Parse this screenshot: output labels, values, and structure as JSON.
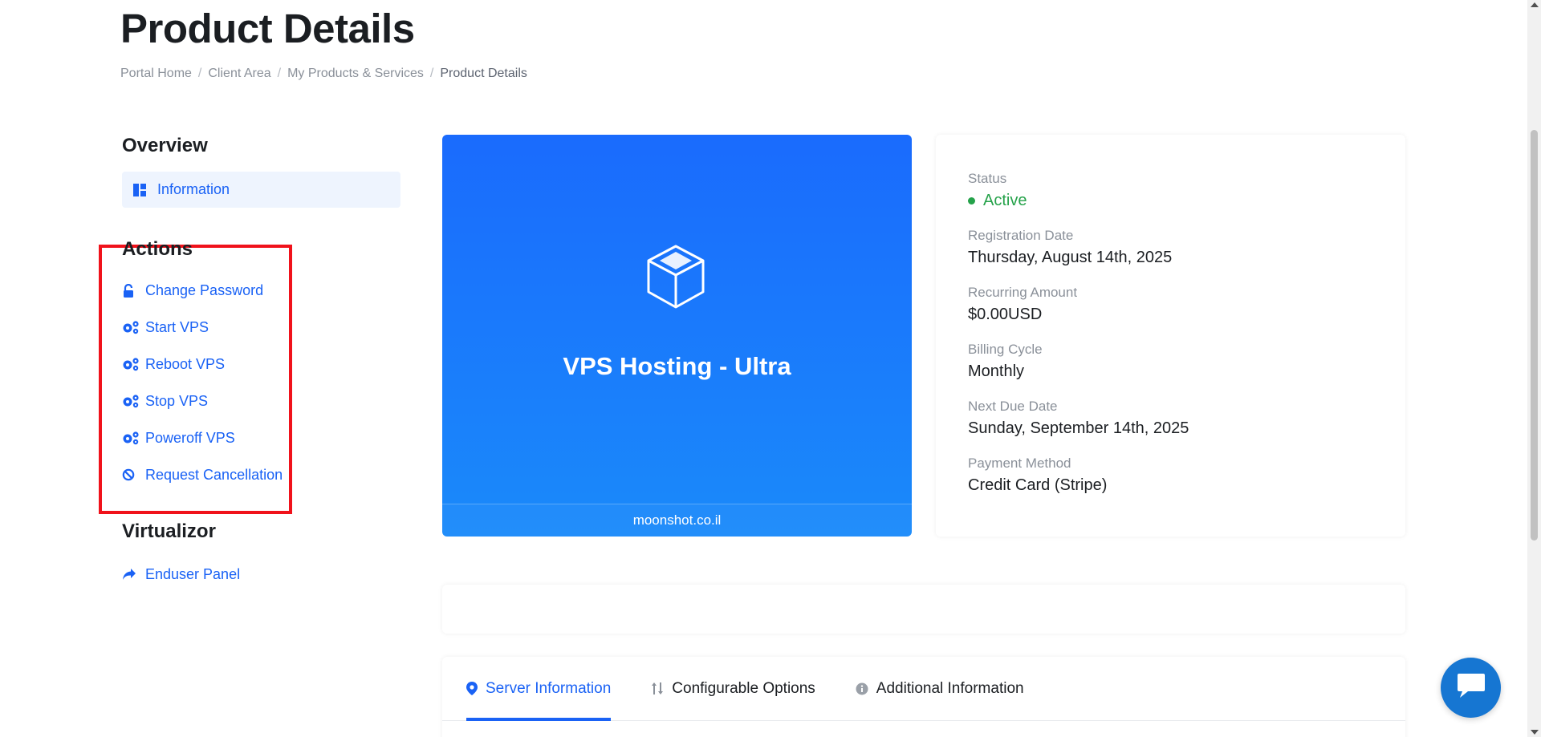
{
  "page": {
    "title": "Product Details"
  },
  "breadcrumb": [
    {
      "label": "Portal Home"
    },
    {
      "label": "Client Area"
    },
    {
      "label": "My Products & Services"
    },
    {
      "label": "Product Details"
    }
  ],
  "sidebar": {
    "overview": {
      "heading": "Overview",
      "items": [
        {
          "label": "Information",
          "icon": "dashboard-icon"
        }
      ]
    },
    "actions": {
      "heading": "Actions",
      "items": [
        {
          "label": "Change Password",
          "icon": "unlock-icon"
        },
        {
          "label": "Start VPS",
          "icon": "cogs-icon"
        },
        {
          "label": "Reboot VPS",
          "icon": "cogs-icon"
        },
        {
          "label": "Stop VPS",
          "icon": "cogs-icon"
        },
        {
          "label": "Poweroff VPS",
          "icon": "cogs-icon"
        },
        {
          "label": "Request Cancellation",
          "icon": "ban-icon"
        }
      ]
    },
    "virtualizor": {
      "heading": "Virtualizor",
      "items": [
        {
          "label": "Enduser Panel",
          "icon": "share-icon"
        }
      ]
    }
  },
  "product": {
    "name": "VPS Hosting - Ultra",
    "domain": "moonshot.co.il",
    "icon": "cube-icon",
    "gradient_top": "#1a6bfd",
    "gradient_bottom": "#1a8afa"
  },
  "details": {
    "status_label": "Status",
    "status_value": "Active",
    "status_color": "#25a24a",
    "registration_label": "Registration Date",
    "registration_value": "Thursday, August 14th, 2025",
    "recurring_label": "Recurring Amount",
    "recurring_value": "$0.00USD",
    "billing_label": "Billing Cycle",
    "billing_value": "Monthly",
    "next_due_label": "Next Due Date",
    "next_due_value": "Sunday, September 14th, 2025",
    "payment_label": "Payment Method",
    "payment_value": "Credit Card (Stripe)"
  },
  "tabs": [
    {
      "label": "Server Information",
      "icon": "map-marker-icon",
      "active": true
    },
    {
      "label": "Configurable Options",
      "icon": "sort-arrows-icon",
      "active": false
    },
    {
      "label": "Additional Information",
      "icon": "info-circle-icon",
      "active": false
    }
  ],
  "colors": {
    "accent": "#1a62f5",
    "highlight_box": "#f0121b",
    "chat_button": "#1676d2"
  },
  "chat": {
    "icon": "chat-bubble-icon"
  }
}
